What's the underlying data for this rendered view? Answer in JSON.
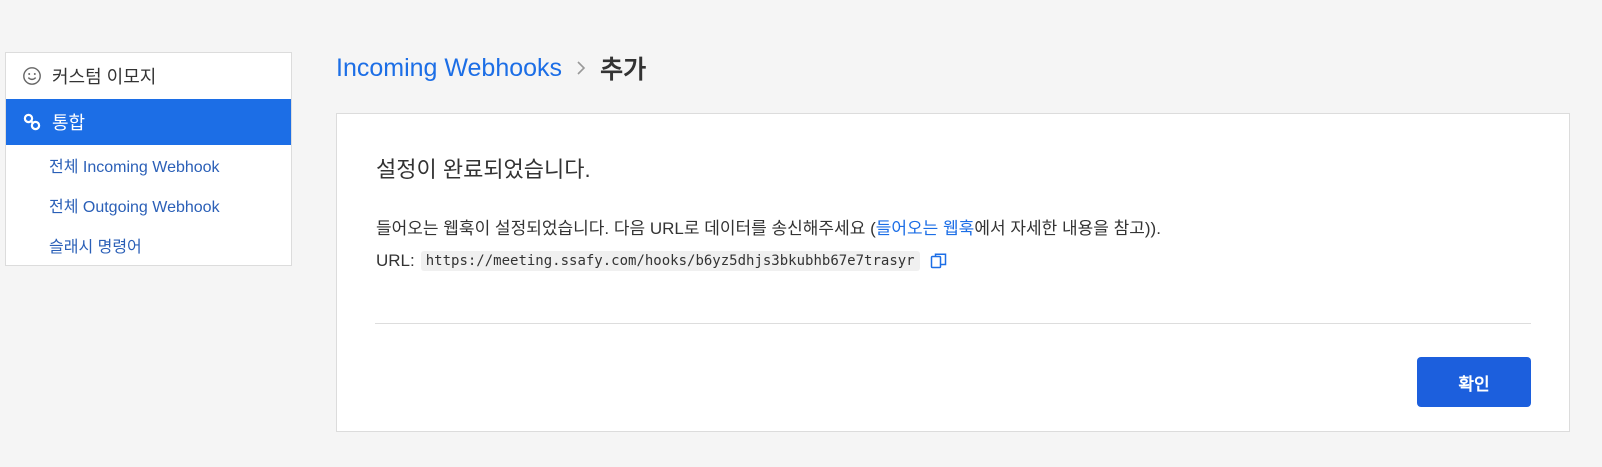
{
  "sidebar": {
    "items": [
      {
        "icon": "smiley-icon",
        "label": "커스텀 이모지",
        "active": false
      },
      {
        "icon": "link-icon",
        "label": "통합",
        "active": true
      }
    ],
    "sub_items": [
      {
        "label": "전체 Incoming Webhook"
      },
      {
        "label": "전체 Outgoing Webhook"
      },
      {
        "label": "슬래시 명령어"
      }
    ]
  },
  "header": {
    "breadcrumb_link": "Incoming Webhooks",
    "breadcrumb_current": "추가"
  },
  "main": {
    "title": "설정이 완료되었습니다.",
    "description_before": "들어오는 웹훅이 설정되었습니다. 다음 URL로 데이터를 송신해주세요 (",
    "description_link": "들어오는 웹훅",
    "description_after": "에서 자세한 내용을 참고)).",
    "url_label": "URL:",
    "url_value": "https://meeting.ssafy.com/hooks/b6yz5dhjs3bkubhb67e7trasyr",
    "copy_icon": "copy-icon",
    "confirm_label": "확인"
  },
  "colors": {
    "accent": "#1c6ee6",
    "button": "#1c5fdd",
    "background": "#f5f5f5"
  }
}
